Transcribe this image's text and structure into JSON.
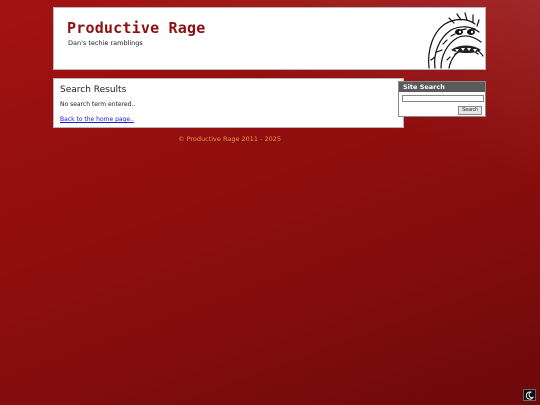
{
  "header": {
    "site_title": "Productive Rage",
    "tagline": "Dan's techie ramblings"
  },
  "main": {
    "heading": "Search Results",
    "message": "No search term entered..",
    "home_link": "Back to the home page.."
  },
  "sidebar": {
    "search_title": "Site Search",
    "search_value": "",
    "search_button": "Search"
  },
  "footer": {
    "copyright": "© Productive Rage 2011 - 2025"
  },
  "icons": {
    "mascot": "fuzzy-monster-mascot",
    "theme_toggle": "moon-icon"
  },
  "colors": {
    "background": "#8f0e0e",
    "title": "#8c1010",
    "footer_text": "#e69a4a",
    "link": "#1a1ad0"
  }
}
